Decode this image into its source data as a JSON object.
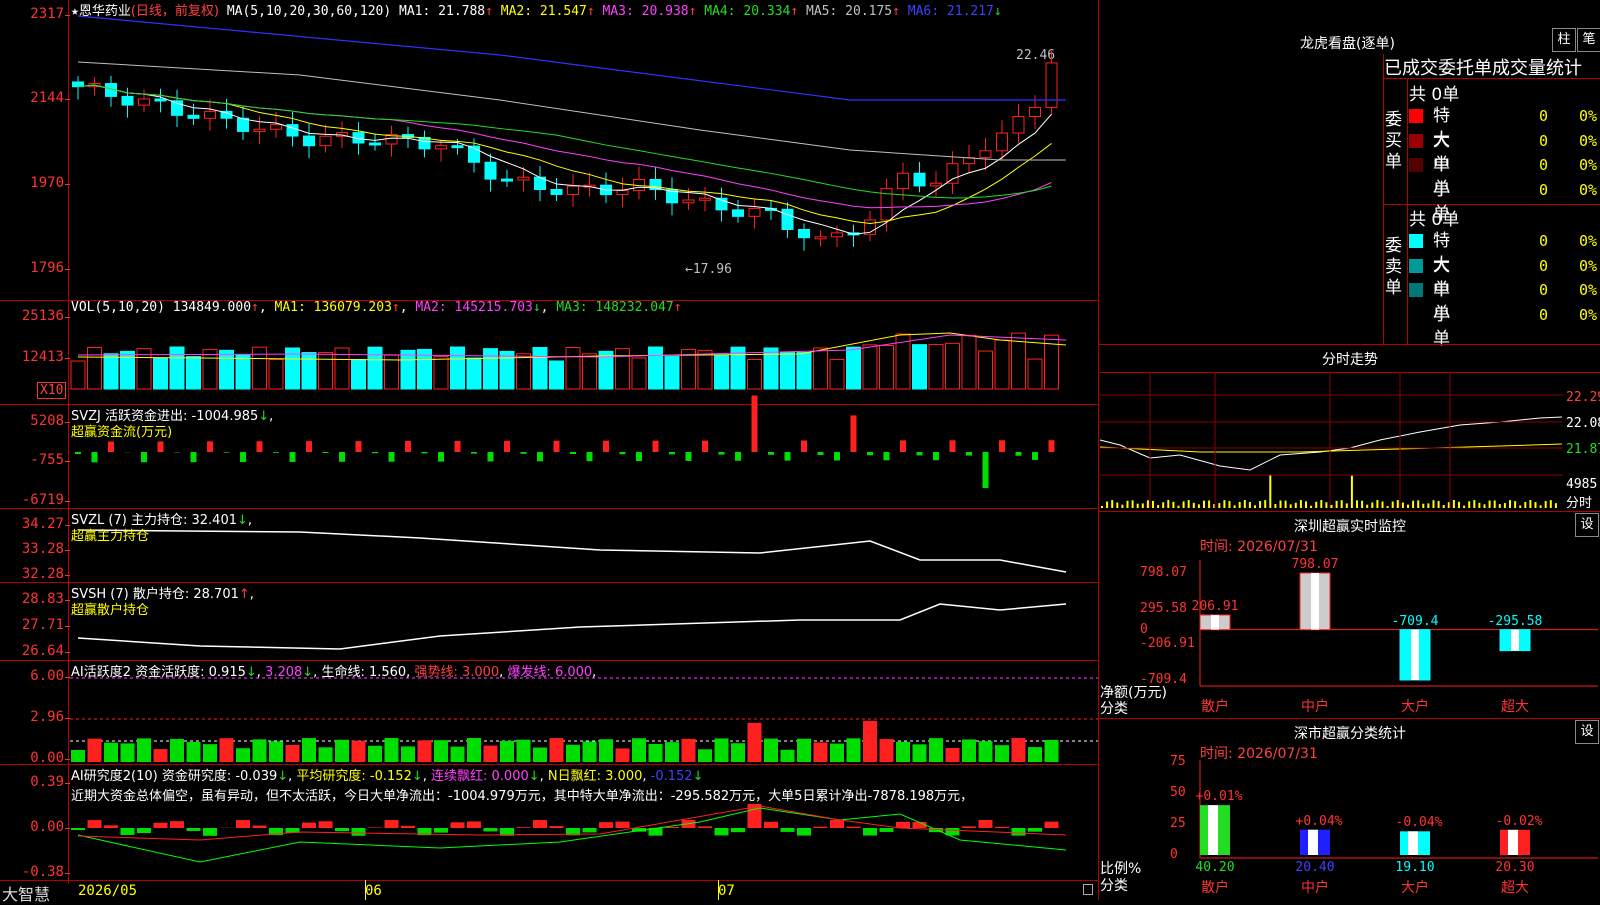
{
  "stock": {
    "star": "★",
    "name": "恩华药业",
    "period": "(日线，前复权)"
  },
  "main_info": {
    "ma_params": "MA(5,10,20,30,60,120)",
    "items": [
      {
        "label": "MA1:",
        "value": "21.788",
        "arrow": "↑",
        "color": "#ffffff"
      },
      {
        "label": "MA2:",
        "value": "21.547",
        "arrow": "↑",
        "color": "#ffff00"
      },
      {
        "label": "MA3:",
        "value": "20.938",
        "arrow": "↑",
        "color": "#ff40ff"
      },
      {
        "label": "MA4:",
        "value": "20.334",
        "arrow": "↑",
        "color": "#22dd22"
      },
      {
        "label": "MA5:",
        "value": "20.175",
        "arrow": "↑",
        "color": "#c0c0c0"
      },
      {
        "label": "MA6:",
        "value": "21.217",
        "arrow": "↓",
        "color": "#4040ff"
      }
    ],
    "y_labels": [
      "2317",
      "2144",
      "1970",
      "1796"
    ],
    "high_label": "22.46",
    "low_label": "←17.96"
  },
  "vol": {
    "params": "VOL(5,10,20)",
    "value": "134849.000",
    "ma1": "MA1: 136079.203",
    "ma2": "MA2: 145215.703",
    "ma3": "MA3: 148232.047",
    "y_labels": [
      "25136",
      "12413"
    ],
    "unit": "X10"
  },
  "svzj": {
    "name": "SVZJ",
    "line": "活跃资金进出: -1004.985",
    "sub": "超赢资金流(万元)",
    "y_labels": [
      "5208",
      "-755",
      "-6719"
    ]
  },
  "svzl": {
    "name": "SVZL (7)",
    "line": "主力持仓: 32.401",
    "sub": "超赢主力持仓",
    "y_labels": [
      "34.27",
      "33.28",
      "32.28"
    ]
  },
  "svsh": {
    "name": "SVSH (7)",
    "line": "散户持仓: 28.701",
    "sub": "超赢散户持仓",
    "y_labels": [
      "28.83",
      "27.71",
      "26.64"
    ]
  },
  "ai1": {
    "name": "AI活跃度2",
    "a": "资金活跃度: 0.915",
    "b": "3.208",
    "c": "生命线: 1.560",
    "d": "强势线: 3.000",
    "e": "爆发线: 6.000",
    "y_labels": [
      "6.00",
      "2.96",
      "0.00"
    ]
  },
  "ai2": {
    "name": "AI研究度2(10)",
    "a": "资金研究度: -0.039",
    "b": "平均研究度: -0.152",
    "c": "连续飘红: 0.000",
    "d": "N日飘红: 3.000",
    "e": "-0.152",
    "comment": "近期大资金总体偏空，虽有异动，但不太活跃，今日大单净流出：-1004.979万元，其中特大单净流出：-295.582万元，大单5日累计净出-7878.198万元，",
    "y_labels": [
      "0.39",
      "0.00",
      "-0.38"
    ]
  },
  "xaxis": {
    "brand": "大智慧",
    "labels": [
      "2026/05",
      "06",
      "07"
    ]
  },
  "right": {
    "dragon_title": "龙虎看盘(逐单)",
    "btn1": "柱",
    "btn2": "笔",
    "tabs": "已成交委托单成交量统计",
    "buy_side": "委买单",
    "sell_side": "委卖单",
    "buy_total": "共 0单",
    "sell_total": "共 0单",
    "buy_rows": [
      {
        "label": "特大",
        "n": "0",
        "pct": "0%",
        "color": "#ff0000"
      },
      {
        "label": "大单",
        "n": "0",
        "pct": "0%",
        "color": "#990000"
      },
      {
        "label": "中单",
        "n": "0",
        "pct": "0%",
        "color": "#550000"
      },
      {
        "label": "小单",
        "n": "0",
        "pct": "0%",
        "color": "#000000"
      }
    ],
    "sell_rows": [
      {
        "label": "特大",
        "n": "0",
        "pct": "0%",
        "color": "#00ffff"
      },
      {
        "label": "大单",
        "n": "0",
        "pct": "0%",
        "color": "#009999"
      },
      {
        "label": "中单",
        "n": "0",
        "pct": "0%",
        "color": "#007777"
      },
      {
        "label": "小单",
        "n": "0",
        "pct": "0%",
        "color": "#000000"
      }
    ],
    "minute_title": "分时走势",
    "minute_labels": [
      "22.29",
      "22.08",
      "21.87",
      "4985",
      "分时"
    ],
    "monitor": {
      "title": "深圳超赢实时监控",
      "gear": "设",
      "time": "时间: 2026/07/31",
      "y_labels": [
        "798.07",
        "295.58",
        "0",
        "-206.91",
        "-709.4"
      ],
      "unit1": "净额(万元)",
      "unit2": "分类",
      "categories": [
        "散户",
        "中户",
        "大户",
        "超大"
      ],
      "values": [
        206.91,
        798.07,
        -709.4,
        -295.58
      ],
      "value_labels": [
        "206.91",
        "798.07",
        "-709.4",
        "-295.58"
      ]
    },
    "classify": {
      "title": "深市超赢分类统计",
      "gear": "设",
      "time": "时间: 2026/07/31",
      "y_labels": [
        "75",
        "50",
        "25",
        "0"
      ],
      "unit1": "比例%",
      "unit2": "分类",
      "categories": [
        "散户",
        "中户",
        "大户",
        "超大"
      ],
      "values": [
        40.2,
        20.4,
        19.1,
        20.3
      ],
      "value_labels": [
        "40.20",
        "20.40",
        "19.10",
        "20.30"
      ],
      "changes": [
        "+0.01%",
        "+0.04%",
        "-0.04%",
        "-0.02%"
      ]
    }
  },
  "chart_data": [
    {
      "type": "bar",
      "title": "深圳超赢实时监控",
      "xlabel": "分类",
      "ylabel": "净额(万元)",
      "categories": [
        "散户",
        "中户",
        "大户",
        "超大"
      ],
      "values": [
        206.91,
        798.07,
        -709.4,
        -295.58
      ],
      "ylim": [
        -709.4,
        798.07
      ]
    },
    {
      "type": "bar",
      "title": "深市超赢分类统计",
      "xlabel": "分类",
      "ylabel": "比例%",
      "categories": [
        "散户",
        "中户",
        "大户",
        "超大"
      ],
      "values": [
        40.2,
        20.4,
        19.1,
        20.3
      ],
      "ylim": [
        0,
        75
      ]
    }
  ]
}
